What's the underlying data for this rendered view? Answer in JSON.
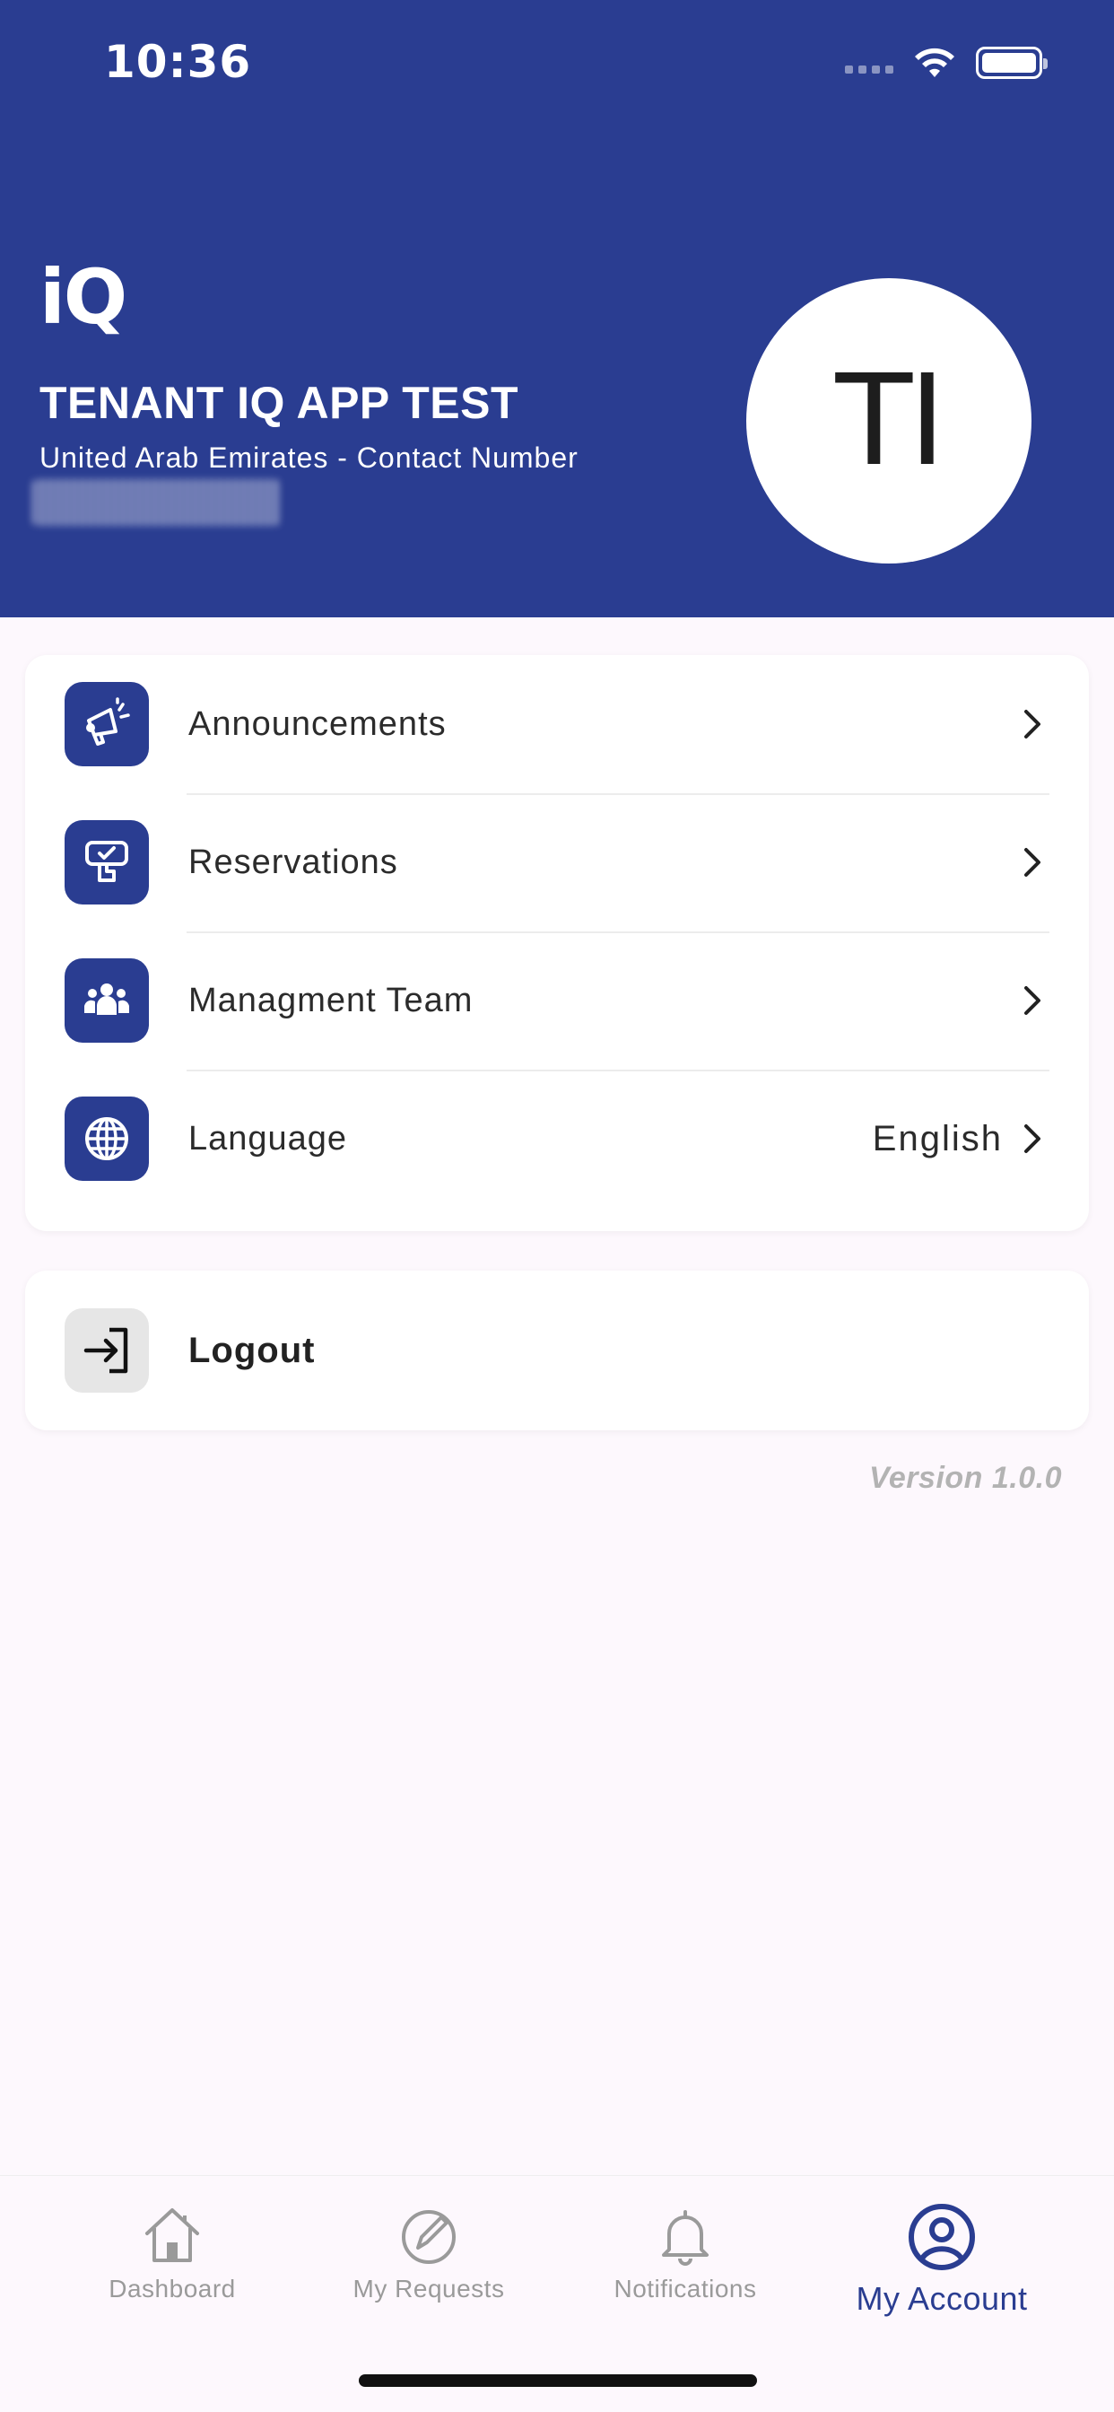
{
  "status_bar": {
    "time": "10:36"
  },
  "header": {
    "logo": "iQ",
    "user_name": "TENANT IQ APP TEST",
    "subtitle": "United Arab Emirates - Contact Number",
    "avatar_initials": "TI"
  },
  "menu": {
    "items": [
      {
        "label": "Announcements",
        "icon": "megaphone-icon"
      },
      {
        "label": "Reservations",
        "icon": "reservation-icon"
      },
      {
        "label": "Managment Team",
        "icon": "team-icon"
      },
      {
        "label": "Language",
        "icon": "globe-icon",
        "value": "English"
      }
    ]
  },
  "logout": {
    "label": "Logout",
    "icon": "logout-icon"
  },
  "version": "Version 1.0.0",
  "tabbar": {
    "tabs": [
      {
        "label": "Dashboard",
        "icon": "home-icon"
      },
      {
        "label": "My Requests",
        "icon": "edit-circle-icon"
      },
      {
        "label": "Notifications",
        "icon": "bell-icon"
      },
      {
        "label": "My Account",
        "icon": "account-icon",
        "active": true
      }
    ]
  },
  "colors": {
    "primary": "#2a3d91",
    "background": "#fdf8fd",
    "inactive": "#9a9a9a"
  }
}
